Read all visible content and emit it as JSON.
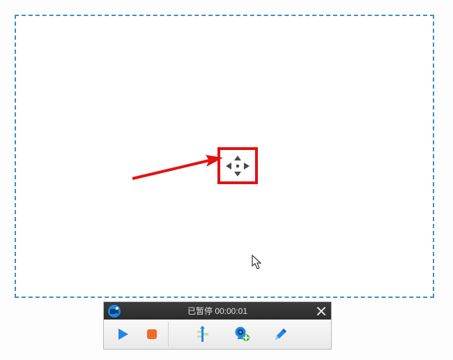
{
  "status": {
    "label": "已暂停",
    "time": "00:00:01"
  },
  "colors": {
    "dashed_border": "#3a8dc8",
    "highlight_box": "#e31111",
    "arrow": "#e31111",
    "play": "#1e88e5",
    "stop": "#f26a2a",
    "accent_blue": "#1e88e5",
    "accent_green": "#3fb24c"
  },
  "icons": {
    "app": "camera-icon",
    "close": "close-icon",
    "play": "play-icon",
    "stop": "stop-icon",
    "trim": "trim-icon",
    "webcam_add": "webcam-add-icon",
    "pencil": "pencil-icon",
    "move_handle": "move-handle-icon",
    "cursor": "cursor-icon",
    "annotation_arrow": "arrow-annotation-icon"
  }
}
